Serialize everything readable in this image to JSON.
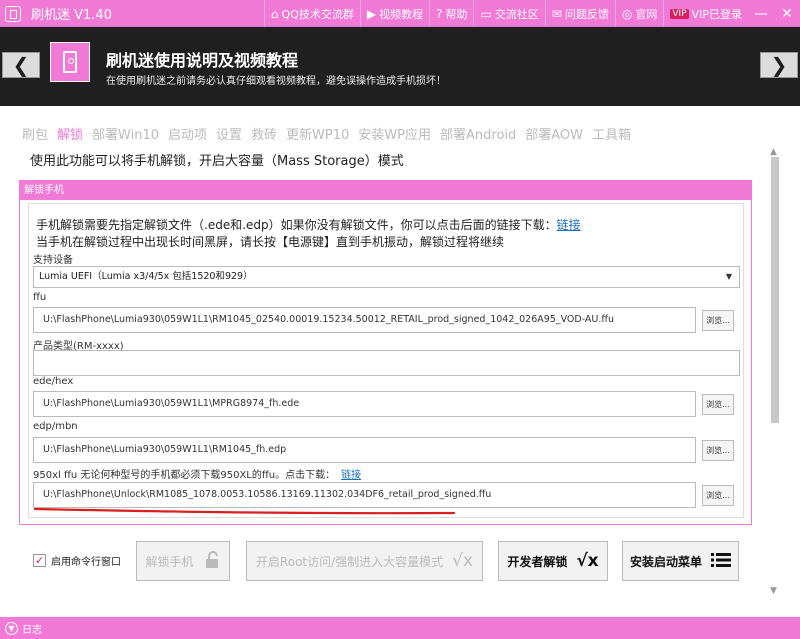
{
  "app": {
    "title": "刷机迷 V1.40"
  },
  "top_menu": [
    {
      "icon": "qq-icon",
      "glyph": "⌂",
      "label": "QQ技术交流群"
    },
    {
      "icon": "video-icon",
      "glyph": "▶",
      "label": "视频教程"
    },
    {
      "icon": "help-icon",
      "glyph": "?",
      "label": "帮助"
    },
    {
      "icon": "community-icon",
      "glyph": "▭",
      "label": "交流社区"
    },
    {
      "icon": "feedback-icon",
      "glyph": "✉",
      "label": "问题反馈"
    },
    {
      "icon": "globe-icon",
      "glyph": "◎",
      "label": "官网"
    },
    {
      "icon": "vip-icon",
      "badge": "VIP",
      "label": "VIP已登录"
    }
  ],
  "window_controls": {
    "minimize": "—",
    "close": "✕"
  },
  "header": {
    "title": "刷机迷使用说明及视频教程",
    "subtitle": "在使用刷机迷之前请务必认真仔细观看视频教程，避免误操作造成手机损坏！",
    "left_arrow": "❮",
    "right_arrow": "❯"
  },
  "tabs": [
    {
      "label": "刷包",
      "active": false
    },
    {
      "label": "解锁",
      "active": true
    },
    {
      "label": "部署Win10",
      "active": false
    },
    {
      "label": "启动项",
      "active": false
    },
    {
      "label": "设置",
      "active": false
    },
    {
      "label": "救砖",
      "active": false
    },
    {
      "label": "更新WP10",
      "active": false
    },
    {
      "label": "安装WP应用",
      "active": false
    },
    {
      "label": "部署Android",
      "active": false
    },
    {
      "label": "部署AOW",
      "active": false
    },
    {
      "label": "工具箱",
      "active": false
    }
  ],
  "description": "使用此功能可以将手机解锁，开启大容量（Mass Storage）模式",
  "panel": {
    "title": "解锁手机",
    "info_line1": "手机解锁需要先指定解锁文件（.ede和.edp）如果你没有解锁文件，你可以点击后面的链接下载：",
    "info_link": "链接",
    "info_line2": "当手机在解锁过程中出现长时间黑屏，请长按【电源键】直到手机振动，解锁过程将继续",
    "device_label": "支持设备",
    "device_value": "Lumia UEFI（Lumia x3/4/5x 包括1520和929）",
    "ffu_label": "ffu",
    "ffu_value": "U:\\FlashPhone\\Lumia930\\059W1L1\\RM1045_02540.00019.15234.50012_RETAIL_prod_signed_1042_026A95_VOD-AU.ffu",
    "product_label": "产品类型(RM-xxxx)",
    "product_value": "",
    "ede_label": "ede/hex",
    "ede_value": "U:\\FlashPhone\\Lumia930\\059W1L1\\MPRG8974_fh.ede",
    "edp_label": "edp/mbn",
    "edp_value": "U:\\FlashPhone\\Lumia930\\059W1L1\\RM1045_fh.edp",
    "ffu950_label": "950xl ffu    无论何种型号的手机都必须下载950XL的ffu。点击下载：",
    "ffu950_link": "链接",
    "ffu950_value": "U:\\FlashPhone\\Unlock\\RM1085_1078.0053.10586.13169.11302.034DF6_retail_prod_signed.ffu",
    "browse_label": "浏览..."
  },
  "bottom": {
    "checkbox_label": "启用命令行窗口",
    "checkbox_checked": true,
    "btn_unlock": "解锁手机",
    "btn_root": "开启Root访问/强制进入大容量模式",
    "btn_dev": "开发者解锁",
    "btn_boot": "安装启动菜单"
  },
  "status": {
    "log_label": "日志"
  },
  "colors": {
    "accent": "#f07ad6",
    "header_bg": "#1f1f1f",
    "link": "#1b6fb8",
    "annotation_red": "#d82020"
  }
}
